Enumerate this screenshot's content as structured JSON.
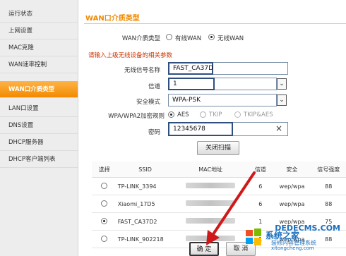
{
  "sidebar": {
    "items": [
      {
        "label": "运行状态",
        "active": false
      },
      {
        "label": "上网设置",
        "active": false
      },
      {
        "label": "MAC克隆",
        "active": false
      },
      {
        "label": "WAN速率控制",
        "active": false
      },
      {
        "label": "WAN口介质类型",
        "active": true
      },
      {
        "label": "LAN口设置",
        "active": false
      },
      {
        "label": "DNS设置",
        "active": false
      },
      {
        "label": "DHCP服务器",
        "active": false
      },
      {
        "label": "DHCP客户端列表",
        "active": false
      }
    ]
  },
  "main": {
    "title": "WAN口介质类型",
    "wan_type_label": "WAN介质类型",
    "wan_options": [
      "有线WAN",
      "无线WAN"
    ],
    "wan_selected": "无线WAN",
    "notice": "请输入上级无线设备的相关参数",
    "ssid_label": "无线信号名称",
    "ssid_value": "FAST_CA37D2",
    "channel_label": "信道",
    "channel_value": "1",
    "security_label": "安全模式",
    "security_value": "WPA-PSK",
    "encryption_label": "WPA/WPA2加密规则",
    "encryption_options": [
      "AES",
      "TKIP",
      "TKIP&AES"
    ],
    "encryption_selected": "AES",
    "password_label": "密码",
    "password_value": "12345678",
    "clear_icon": "×",
    "scan_off_button": "关闭扫描"
  },
  "scan_table": {
    "headers": [
      "选择",
      "SSID",
      "MAC地址",
      "信道",
      "安全",
      "信号强度"
    ],
    "rows": [
      {
        "selected": false,
        "ssid": "TP-LINK_3394",
        "channel": "6",
        "security": "wep/wpa",
        "signal": "88"
      },
      {
        "selected": false,
        "ssid": "Xiaomi_17D5",
        "channel": "6",
        "security": "wep/wpa",
        "signal": "88"
      },
      {
        "selected": true,
        "ssid": "FAST_CA37D2",
        "channel": "1",
        "security": "wep/wpa",
        "signal": "75"
      },
      {
        "selected": false,
        "ssid": "TP-LINK_902218",
        "channel": "1",
        "security": "wep/wpa",
        "signal": "88"
      }
    ]
  },
  "footer": {
    "ok_button": "确 定",
    "cancel_button": "取 消"
  },
  "watermark": {
    "site": "DEDECMS.COM",
    "logo_text": "爱纯",
    "brand": "系统之家",
    "subtitle": "装修内容管理系统",
    "url": "xitongcheng.com"
  },
  "colors": {
    "accent": "#f08a00",
    "active_item": "#f28a00",
    "field_border": "#2f4f7f",
    "arrow": "#d01818",
    "watermark_blue": "#1a6fbf"
  }
}
